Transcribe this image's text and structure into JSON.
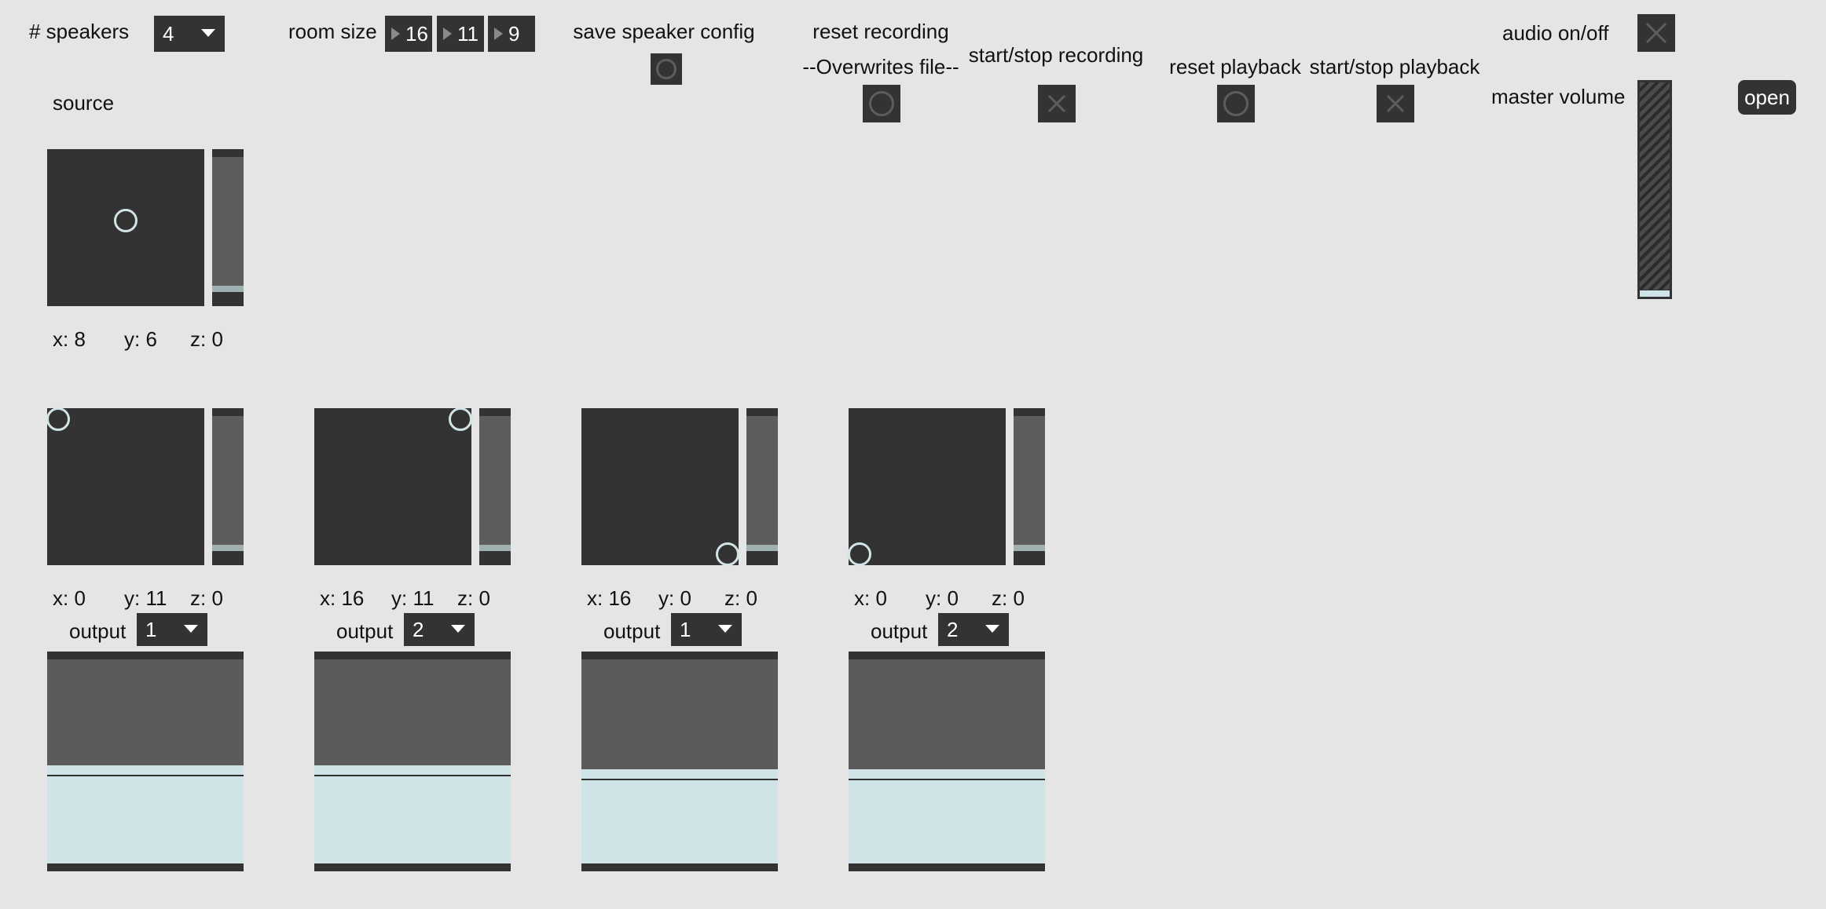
{
  "header": {
    "speakers_label": "# speakers",
    "speakers_value": "4",
    "room_size_label": "room size",
    "room_size": [
      "16",
      "11",
      "9"
    ],
    "save_config_label": "save speaker config",
    "reset_recording_label": "reset recording",
    "overwrite_note": "--Overwrites file--",
    "start_stop_recording_label": "start/stop recording",
    "reset_playback_label": "reset playback",
    "start_stop_playback_label": "start/stop playback",
    "audio_label": "audio on/off",
    "master_volume_label": "master volume",
    "open_label": "open"
  },
  "source": {
    "label": "source",
    "x_text": "x: 8",
    "y_text": "y: 6",
    "z_text": "z: 0",
    "x": 8,
    "y": 6,
    "z": 0
  },
  "speakers": [
    {
      "x_text": "x: 0",
      "y_text": "y: 11",
      "z_text": "z: 0",
      "output_label": "output",
      "output": "1",
      "x": 0,
      "y": 11,
      "z": 0,
      "level": 0.48
    },
    {
      "x_text": "x: 16",
      "y_text": "y: 11",
      "z_text": "z: 0",
      "output_label": "output",
      "output": "2",
      "x": 16,
      "y": 11,
      "z": 0,
      "level": 0.48
    },
    {
      "x_text": "x: 16",
      "y_text": "y: 0",
      "z_text": "z: 0",
      "output_label": "output",
      "output": "1",
      "x": 16,
      "y": 0,
      "z": 0,
      "level": 0.46
    },
    {
      "x_text": "x: 0",
      "y_text": "y: 0",
      "z_text": "z: 0",
      "output_label": "output",
      "output": "2",
      "x": 0,
      "y": 0,
      "z": 0,
      "level": 0.46
    }
  ],
  "room": {
    "x": 16,
    "y": 11,
    "z": 9
  },
  "master_volume_level": 0.03,
  "colors": {
    "background": "#e5e5e5",
    "panel": "#333333",
    "accent": "#d0e3e6"
  }
}
